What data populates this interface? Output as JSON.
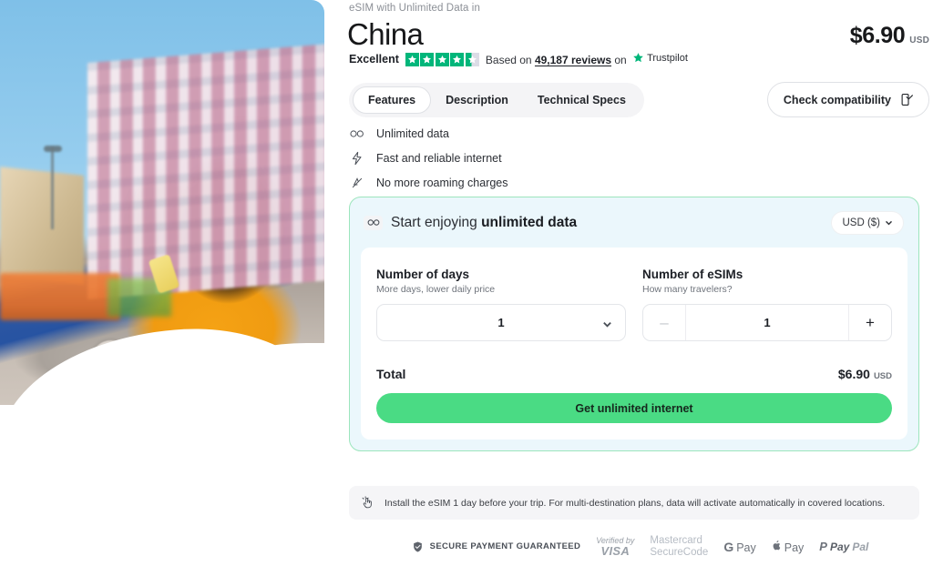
{
  "hero": {
    "alt": "Woman in yellow sweater using a smartphone on a city street"
  },
  "product": {
    "eyebrow": "eSIM with Unlimited Data in",
    "title": "China",
    "price": "$6.90",
    "currency_code": "USD"
  },
  "rating": {
    "word": "Excellent",
    "stars_total": 5,
    "stars_filled": 4.4,
    "based_on_prefix": "Based on",
    "reviews_link": "49,187 reviews",
    "on_word": "on",
    "provider": "Trustpilot"
  },
  "tabs": [
    {
      "label": "Features",
      "active": true
    },
    {
      "label": "Description",
      "active": false
    },
    {
      "label": "Technical Specs",
      "active": false
    }
  ],
  "compatibility": {
    "label": "Check compatibility",
    "icon": "phone-check-icon"
  },
  "features": [
    {
      "icon": "infinity-icon",
      "label": "Unlimited data"
    },
    {
      "icon": "lightning-bolt-icon",
      "label": "Fast and reliable internet"
    },
    {
      "icon": "no-roaming-icon",
      "label": "No more roaming charges"
    }
  ],
  "card": {
    "header": {
      "icon": "infinity-icon",
      "text_plain": "Start enjoying ",
      "text_bold": "unlimited data",
      "currency_selector": "USD ($)"
    },
    "days": {
      "label": "Number of days",
      "sublabel": "More days, lower daily price",
      "value": "1"
    },
    "esims": {
      "label": "Number of eSIMs",
      "sublabel": "How many travelers?",
      "value": "1",
      "minus_label": "–",
      "plus_label": "+",
      "minus_disabled": true
    },
    "total": {
      "label": "Total",
      "price": "$6.90",
      "currency_code": "USD"
    },
    "cta_label": "Get unlimited internet"
  },
  "notice": {
    "icon": "tap-hand-icon",
    "text": "Install the eSIM 1 day before your trip. For multi-destination plans, data will activate automatically in covered locations."
  },
  "payments": {
    "secure_icon": "shield-check-icon",
    "secure_label": "SECURE PAYMENT GUARANTEED",
    "visa_line1": "Verified by",
    "visa_line2": "VISA",
    "mastercard_line1": "Mastercard",
    "mastercard_line2": "SecureCode",
    "gpay_g": "G",
    "gpay_pay": "Pay",
    "apple_mark": "\u0001",
    "apple_pay": "Pay",
    "paypal_mark": "P",
    "paypal_pay": "Pay",
    "paypal_pal": "Pal"
  },
  "colors": {
    "brand_green": "#4adb84",
    "card_border": "#9ce5bd",
    "card_bg": "#ebf7fc",
    "trustpilot_green": "#00b67a",
    "text_primary": "#1d2026",
    "text_muted": "#6f747c"
  }
}
